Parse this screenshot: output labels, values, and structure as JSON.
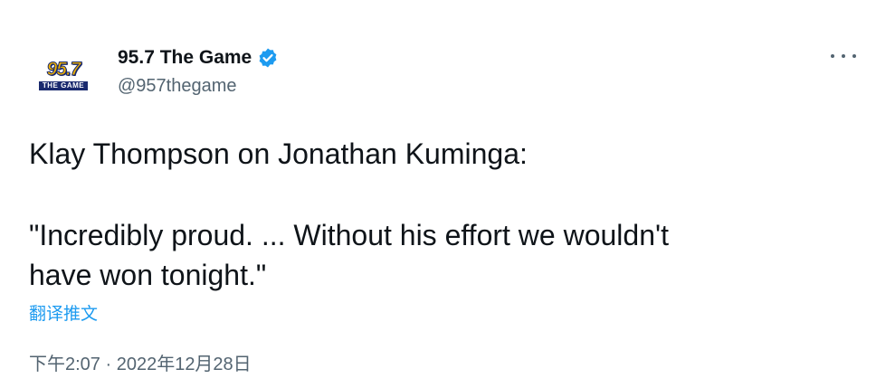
{
  "author": {
    "avatar_text": "95.7",
    "avatar_subtext": "THE GAME",
    "display_name": "95.7 The Game",
    "handle": "@957thegame",
    "verified_icon": "verified-badge-icon",
    "verified_color": "#1d9bf0"
  },
  "menu": {
    "icon": "more-options-icon"
  },
  "tweet": {
    "line1": "Klay Thompson on Jonathan Kuminga:",
    "line2": "\"Incredibly proud. ... Without his effort we wouldn't",
    "line3": "have won tonight.\"",
    "translate_label": "翻译推文",
    "timestamp": "下午2:07 · 2022年12月28日"
  },
  "colors": {
    "link": "#1d9bf0",
    "secondary_text": "#536471",
    "primary_text": "#0f1419"
  }
}
